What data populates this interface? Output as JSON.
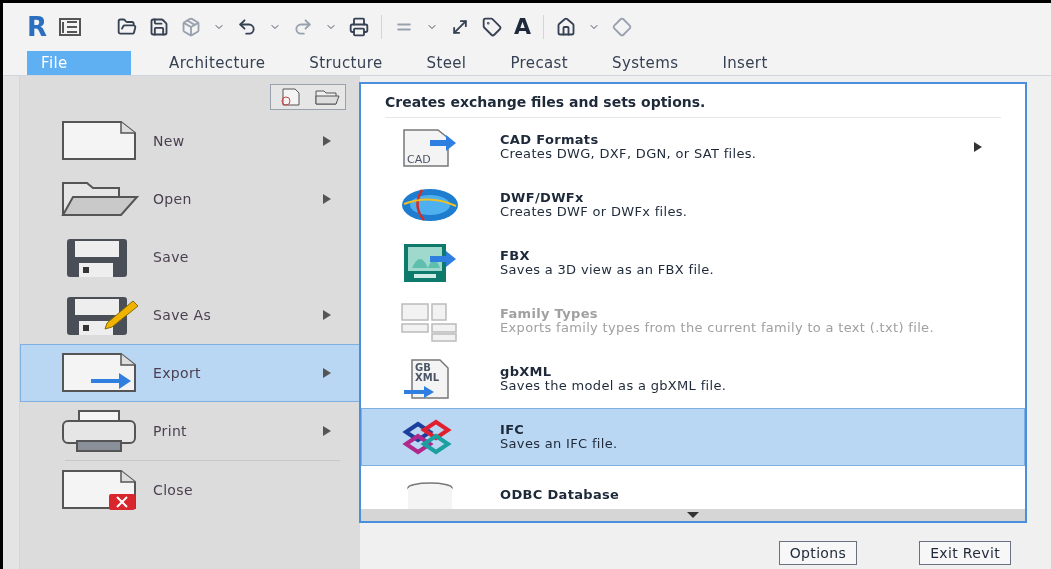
{
  "app": {
    "logo": "R"
  },
  "toolbar": {
    "text_tool": "A"
  },
  "tabs": [
    {
      "label": "File",
      "selected": true
    },
    {
      "label": "Architecture",
      "selected": false
    },
    {
      "label": "Structure",
      "selected": false
    },
    {
      "label": "Steel",
      "selected": false
    },
    {
      "label": "Precast",
      "selected": false
    },
    {
      "label": "Systems",
      "selected": false
    },
    {
      "label": "Insert",
      "selected": false
    }
  ],
  "file_menu": {
    "items": [
      {
        "kind": "new",
        "label": "New",
        "has_submenu": true,
        "selected": false
      },
      {
        "kind": "open",
        "label": "Open",
        "has_submenu": true,
        "selected": false
      },
      {
        "kind": "save",
        "label": "Save",
        "has_submenu": false,
        "selected": false
      },
      {
        "kind": "saveas",
        "label": "Save As",
        "has_submenu": true,
        "selected": false
      },
      {
        "kind": "export",
        "label": "Export",
        "has_submenu": true,
        "selected": true
      },
      {
        "kind": "print",
        "label": "Print",
        "has_submenu": true,
        "selected": false
      },
      {
        "kind": "close",
        "label": "Close",
        "has_submenu": false,
        "selected": false
      }
    ]
  },
  "export_panel": {
    "heading": "Creates exchange files and sets options.",
    "items": [
      {
        "kind": "cad",
        "icon_label": "CAD",
        "title": "CAD Formats",
        "description": "Creates DWG, DXF, DGN, or SAT files.",
        "has_submenu": true,
        "disabled": false,
        "selected": false
      },
      {
        "kind": "dwf",
        "title": "DWF/DWFx",
        "description": "Creates DWF or DWFx files.",
        "has_submenu": false,
        "disabled": false,
        "selected": false
      },
      {
        "kind": "fbx",
        "title": "FBX",
        "description": "Saves a 3D view as an FBX file.",
        "has_submenu": false,
        "disabled": false,
        "selected": false
      },
      {
        "kind": "family",
        "title": "Family Types",
        "description": "Exports family types from the current family to a text (.txt) file.",
        "has_submenu": false,
        "disabled": true,
        "selected": false
      },
      {
        "kind": "gbxml",
        "icon_label": "GB XML",
        "title": "gbXML",
        "description": "Saves the model as a gbXML file.",
        "has_submenu": false,
        "disabled": false,
        "selected": false
      },
      {
        "kind": "ifc",
        "title": "IFC",
        "description": "Saves an IFC file.",
        "has_submenu": false,
        "disabled": false,
        "selected": true
      },
      {
        "kind": "odbc",
        "title": "ODBC Database",
        "has_submenu": false,
        "disabled": false,
        "selected": false
      }
    ]
  },
  "buttons": [
    "Options",
    "Exit Revit"
  ]
}
